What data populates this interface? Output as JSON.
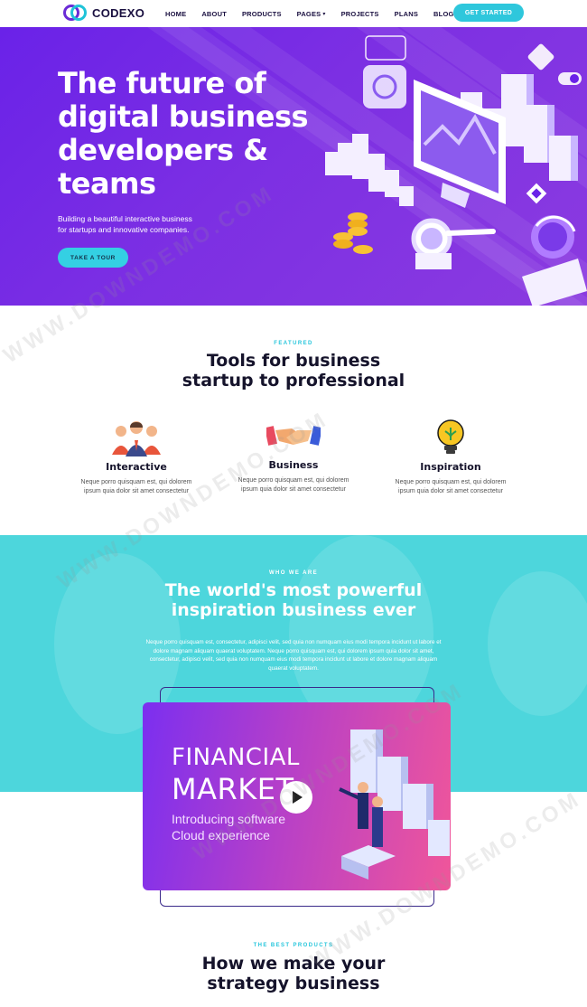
{
  "nav": {
    "brand": "CODEXO",
    "items": [
      {
        "label": "HOME",
        "dropdown": false
      },
      {
        "label": "ABOUT",
        "dropdown": false
      },
      {
        "label": "PRODUCTS",
        "dropdown": false
      },
      {
        "label": "PAGES",
        "dropdown": true
      },
      {
        "label": "PROJECTS",
        "dropdown": false
      },
      {
        "label": "PLANS",
        "dropdown": false
      },
      {
        "label": "BLOGS",
        "dropdown": true
      }
    ],
    "cta_label": "GET STARTED"
  },
  "hero": {
    "title_lines": [
      "The future of",
      "digital business",
      "developers &",
      "teams"
    ],
    "subtitle_lines": [
      "Building a beautiful interactive business",
      "for startups and innovative companies."
    ],
    "button_label": "TAKE A TOUR"
  },
  "featured": {
    "tag": "FEATURED",
    "title_lines": [
      "Tools for business",
      "startup to professional"
    ],
    "items": [
      {
        "title": "Interactive",
        "desc_lines": [
          "Neque porro quisquam est, qui dolorem",
          "ipsum quia dolor sit amet consectetur"
        ],
        "icon": "team-icon"
      },
      {
        "title": "Business",
        "desc_lines": [
          "Neque porro quisquam est, qui dolorem",
          "ipsum quia dolor sit amet consectetur"
        ],
        "icon": "handshake-icon"
      },
      {
        "title": "Inspiration",
        "desc_lines": [
          "Neque porro quisquam est, qui dolorem",
          "ipsum quia dolor sit amet consectetur"
        ],
        "icon": "lightbulb-icon"
      }
    ]
  },
  "who": {
    "tag": "WHO WE ARE",
    "title_lines": [
      "The world's most powerful",
      "inspiration business ever"
    ],
    "body": "Neque porro quisquam est, consectetur, adipisci velit, sed quia non numquam eius modi tempora incidunt ut labore et dolore magnam aliquam quaerat voluptatem. Neque porro quisquam est, qui dolorem ipsum quia dolor sit amet, consectetur, adipisci velit, sed quia non numquam eius modi tempora incidunt ut labore et dolore magnam aliquam quaerat voluptatem."
  },
  "video": {
    "line1": "FINANCIAL",
    "line2": "MARKET",
    "line3": "Introducing software",
    "line4": "Cloud experience"
  },
  "best": {
    "tag": "THE BEST PRODUCTS",
    "title_lines": [
      "How we make your",
      "strategy business"
    ]
  },
  "colors": {
    "hero_purple": "#6a22e8",
    "accent_cyan": "#2ec7dc",
    "who_teal": "#4dd6dc",
    "dark_text": "#15132b"
  },
  "watermark": "WWW.DOWNDEMO.COM"
}
